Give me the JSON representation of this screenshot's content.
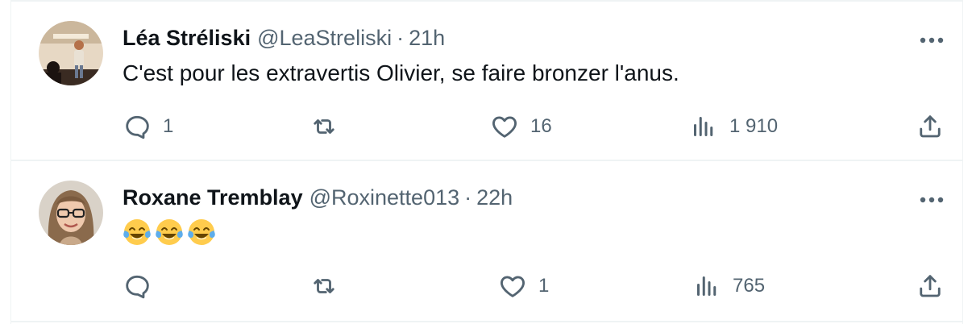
{
  "tweets": [
    {
      "display_name": "Léa Stréliski",
      "handle": "@LeaStreliski",
      "separator": "·",
      "time": "21h",
      "text": "C'est pour les extravertis Olivier, se faire bronzer l'anus.",
      "reply_count": "1",
      "retweet_count": "",
      "like_count": "16",
      "view_count": "1 910",
      "avatar_icon": "stage-performer-avatar"
    },
    {
      "display_name": "Roxane Tremblay",
      "handle": "@Roxinette013",
      "separator": "·",
      "time": "22h",
      "text": "😂😂😂",
      "emoji_icon": "face-with-tears-of-joy",
      "emoji_count": 3,
      "reply_count": "",
      "retweet_count": "",
      "like_count": "1",
      "view_count": "765",
      "avatar_icon": "woman-with-glasses-avatar"
    }
  ],
  "colors": {
    "text_primary": "#0f1419",
    "text_secondary": "#536471",
    "divider": "#eff3f4",
    "emoji_face": "#ffcc4d"
  }
}
